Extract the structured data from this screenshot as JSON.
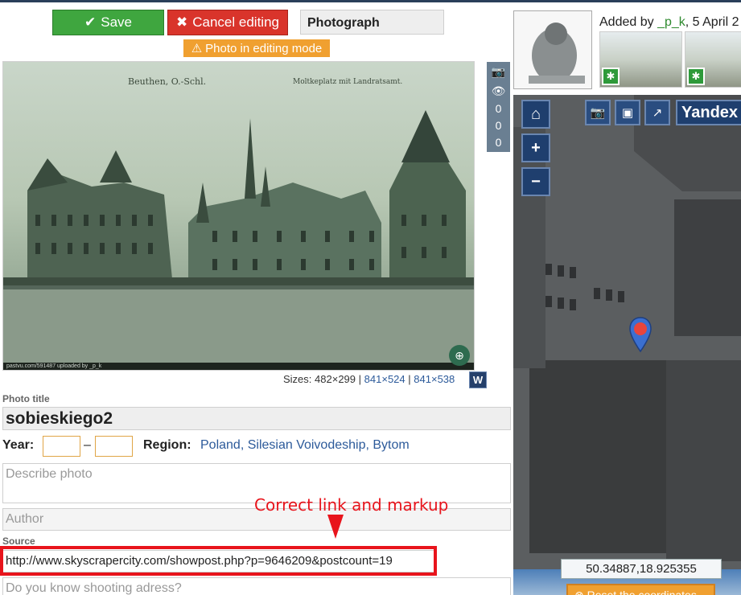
{
  "toolbar": {
    "save_label": "Save",
    "cancel_label": "Cancel editing",
    "photo_type": "Photograph",
    "editing_badge": "Photo in editing mode"
  },
  "photo": {
    "caption_left": "Beuthen, O.-Schl.",
    "caption_right": "Moltkeplatz mit Landratsamt.",
    "watermark": "pastvu.com/591487  uploaded by _p_k"
  },
  "stats": {
    "views_total": "0",
    "views_day": "0",
    "views_week": "0"
  },
  "sizes": {
    "label": "Sizes:",
    "current": "482×299",
    "sep1": "|",
    "link1": "841×524",
    "sep2": "|",
    "link2": "841×538",
    "wiki_btn": "W"
  },
  "form": {
    "title_label": "Photo title",
    "title_value": "sobieskiego2",
    "year_label": "Year:",
    "year_from": "",
    "year_to": "",
    "year_sep": "–",
    "region_label": "Region:",
    "region_value": "Poland, Silesian Voivodeship, Bytom",
    "description_placeholder": "Describe photo",
    "author_placeholder": "Author",
    "source_label": "Source",
    "source_value": "http://www.skyscrapercity.com/showpost.php?p=9646209&postcount=19",
    "address_placeholder": "Do you know shooting adress?"
  },
  "annotation": {
    "text": "Correct link and markup"
  },
  "sidebar": {
    "added_prefix": "Added by ",
    "added_user": "_p_k",
    "added_suffix": ", 5 April 2"
  },
  "map": {
    "provider": "Yandex",
    "coordinates": "50.34887,18.925355",
    "reset_label": "Reset the coordinates"
  },
  "colors": {
    "save_green": "#3fa63f",
    "cancel_red": "#d9342b",
    "badge_orange": "#f0a030",
    "annotation_red": "#e8141c",
    "map_button_blue": "#1f3f6e",
    "link_blue": "#2c5a9a"
  },
  "icons": {
    "save": "check-icon",
    "cancel": "close-icon",
    "badge": "warning-icon",
    "stats_camera": "camera-icon",
    "stats_eye": "eye-icon",
    "zoom": "zoom-in-icon",
    "map_home": "home-icon",
    "map_zoom_in": "plus-icon",
    "map_zoom_out": "minus-icon",
    "map_tool_camera": "camera-icon",
    "map_tool_image": "image-icon",
    "map_tool_share": "share-icon",
    "map_marker": "map-marker-icon"
  }
}
